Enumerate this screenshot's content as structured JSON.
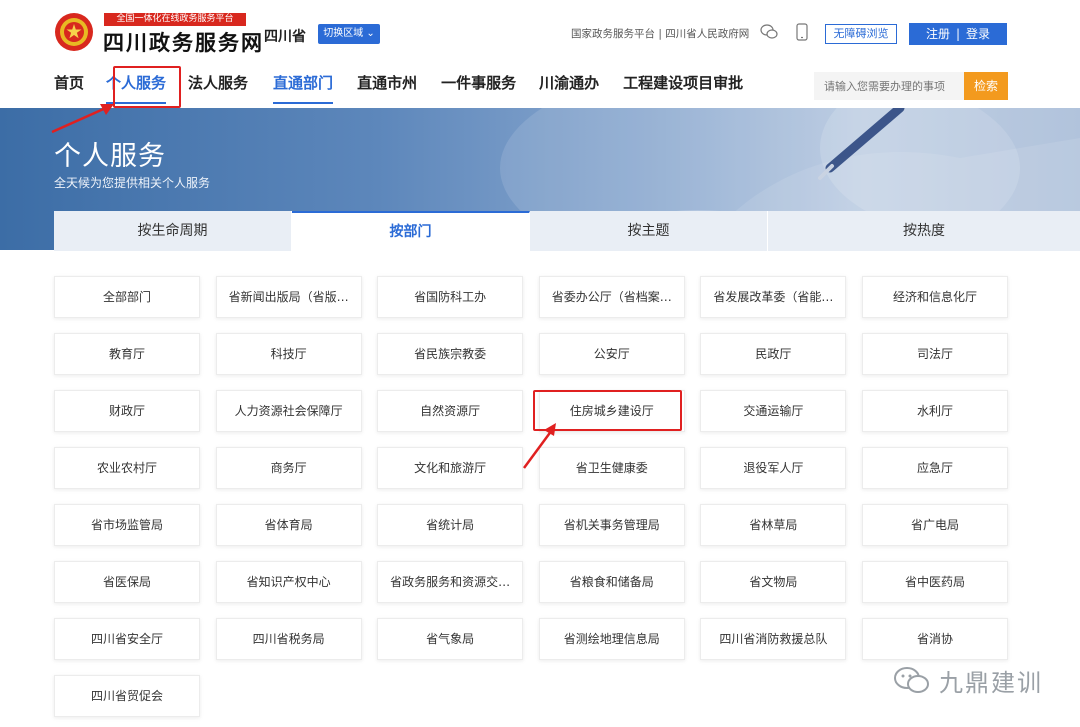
{
  "header": {
    "slogan": "全国一体化在线政务服务平台",
    "site_name": "四川政务服务网",
    "province": "四川省",
    "switch_region": "切换区域 ⌄",
    "top_links": "国家政务服务平台 | 四川省人民政府网",
    "accessibility": "无障碍浏览",
    "register": "注册",
    "separator": "|",
    "login": "登录"
  },
  "nav": {
    "items": [
      {
        "label": "首页"
      },
      {
        "label": "个人服务"
      },
      {
        "label": "法人服务"
      },
      {
        "label": "直通部门"
      },
      {
        "label": "直通市州"
      },
      {
        "label": "一件事服务"
      },
      {
        "label": "川渝通办"
      },
      {
        "label": "工程建设项目审批"
      }
    ],
    "search_placeholder": "请输入您需要办理的事项",
    "search_button": "检索"
  },
  "banner": {
    "title": "个人服务",
    "subtitle": "全天候为您提供相关个人服务"
  },
  "tabs": [
    "按生命周期",
    "按部门",
    "按主题",
    "按热度"
  ],
  "departments": [
    "全部部门",
    "省新闻出版局（省版…",
    "省国防科工办",
    "省委办公厅（省档案…",
    "省发展改革委（省能…",
    "经济和信息化厅",
    "教育厅",
    "科技厅",
    "省民族宗教委",
    "公安厅",
    "民政厅",
    "司法厅",
    "财政厅",
    "人力资源社会保障厅",
    "自然资源厅",
    "住房城乡建设厅",
    "交通运输厅",
    "水利厅",
    "农业农村厅",
    "商务厅",
    "文化和旅游厅",
    "省卫生健康委",
    "退役军人厅",
    "应急厅",
    "省市场监管局",
    "省体育局",
    "省统计局",
    "省机关事务管理局",
    "省林草局",
    "省广电局",
    "省医保局",
    "省知识产权中心",
    "省政务服务和资源交…",
    "省粮食和储备局",
    "省文物局",
    "省中医药局",
    "四川省安全厅",
    "四川省税务局",
    "省气象局",
    "省测绘地理信息局",
    "四川省消防救援总队",
    "省消协",
    "四川省贸促会"
  ],
  "watermark": "九鼎建训",
  "colors": {
    "primary_blue": "#2b6bd6",
    "search_orange": "#f39a1e",
    "highlight_red": "#e02020"
  }
}
